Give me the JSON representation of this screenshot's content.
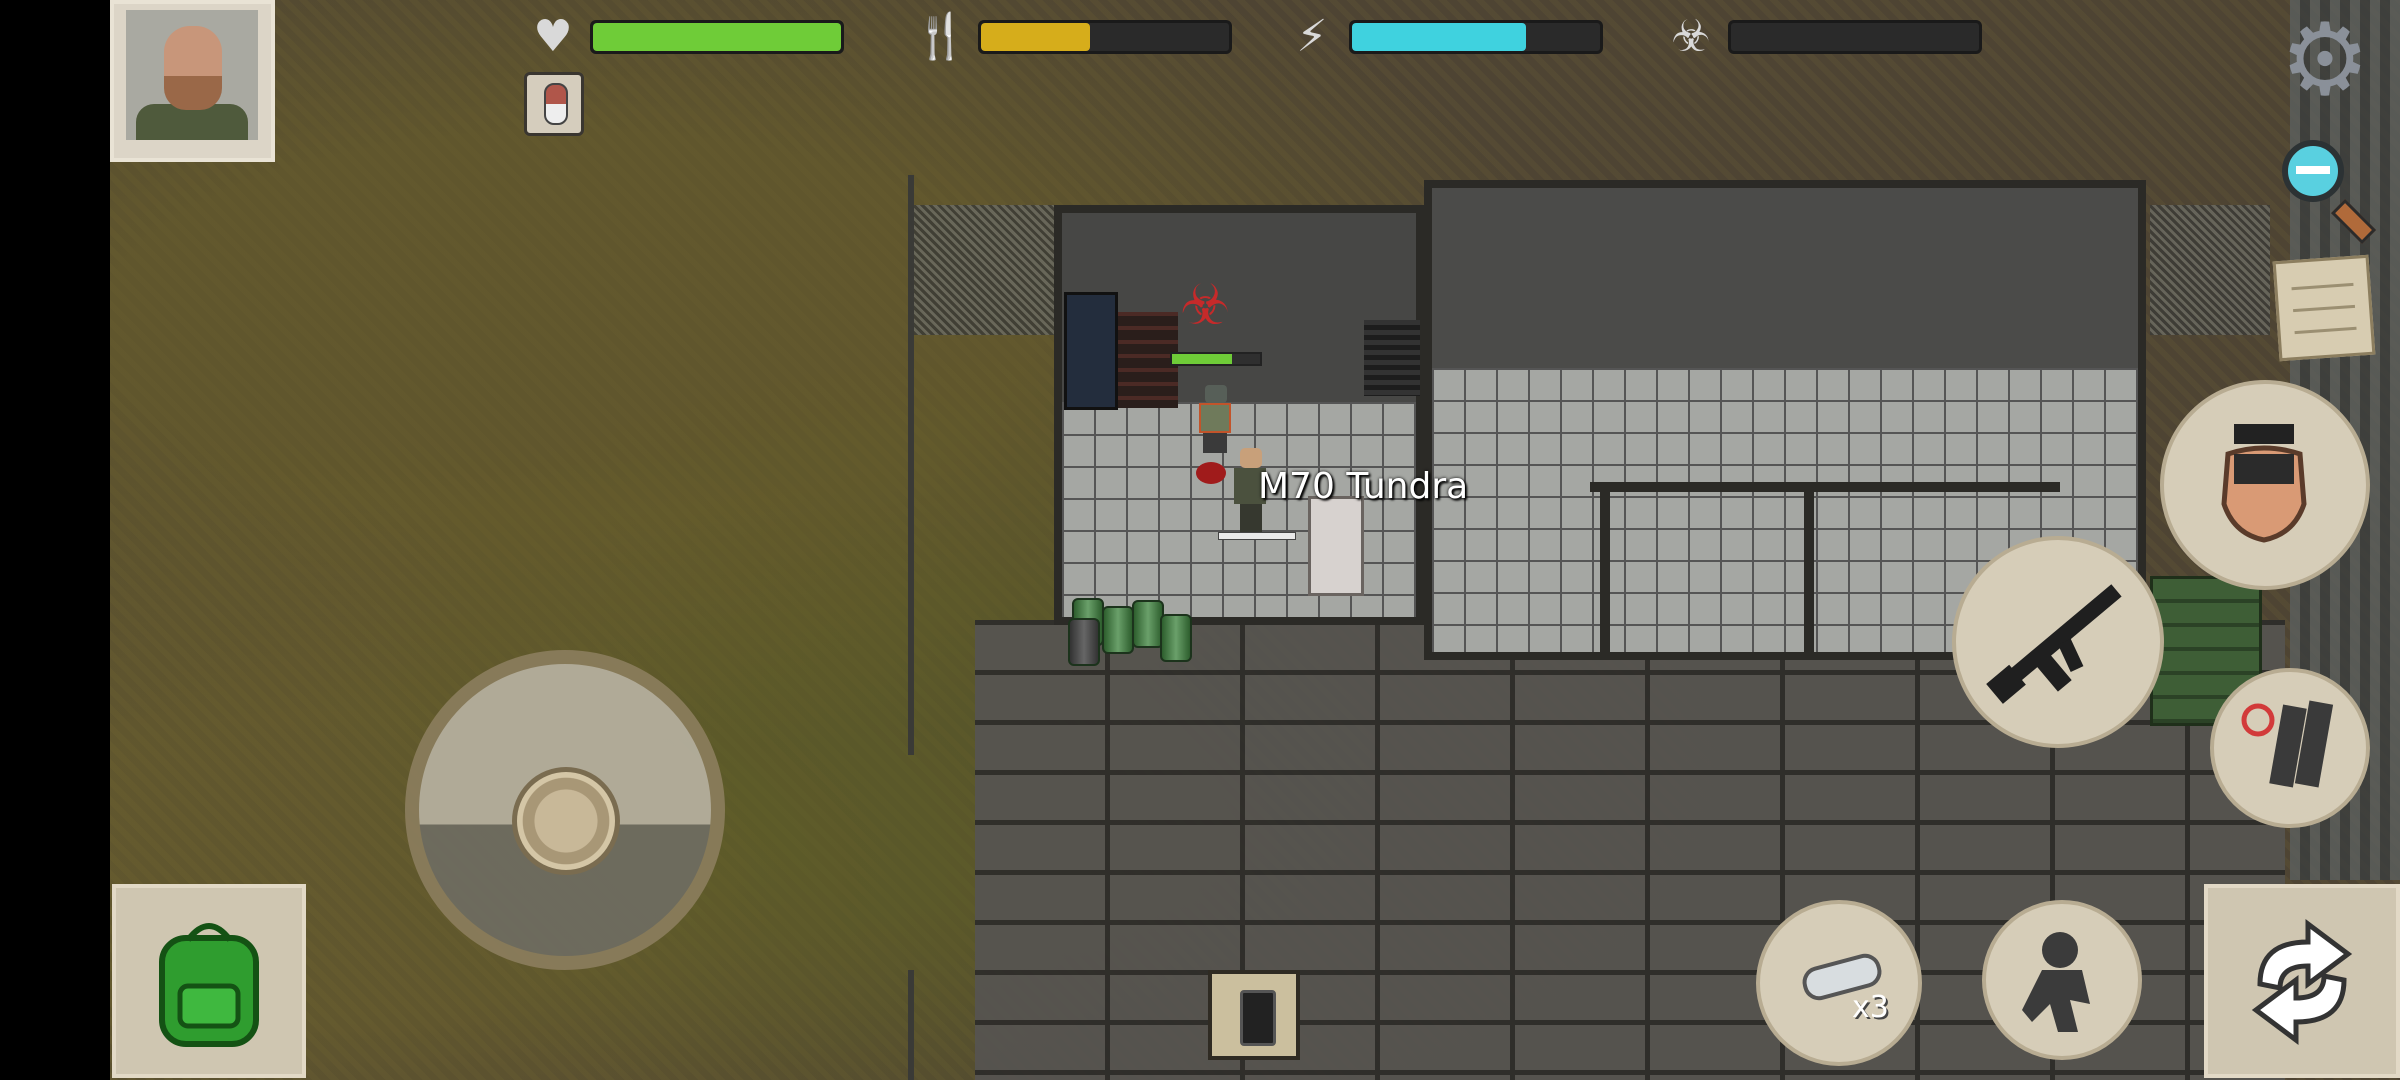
{
  "hud": {
    "stats": [
      {
        "name": "health",
        "icon": "heart-icon",
        "value": 1.0,
        "color": "#6fcc38"
      },
      {
        "name": "hunger",
        "icon": "fork-knife-icon",
        "value": 0.44,
        "color": "#d6ad1b"
      },
      {
        "name": "energy",
        "icon": "energy-head-icon",
        "value": 0.7,
        "color": "#3fd2df"
      },
      {
        "name": "infection",
        "icon": "biohazard-icon",
        "value": 0.0,
        "color": "#8a8a8a"
      }
    ],
    "status_effect_icon": "pill-capsule-icon"
  },
  "world": {
    "item_label": "M70 Tundra",
    "zombie_health": 0.68
  },
  "buttons": {
    "settings_icon": "gear-icon",
    "zoom_icon": "zoom-out-icon",
    "map_icon": "map-icon",
    "grab_icon": "grab-hand-icon",
    "weapon_icon": "assault-rifle-icon",
    "reload_icon": "magazine-reload-icon",
    "inventory_icon": "backpack-icon",
    "quick_slot_icon": "bandage-icon",
    "quick_slot_count": "x3",
    "sneak_icon": "sneak-icon",
    "swap_icon": "swap-arrows-icon",
    "radio_icon": "walkie-talkie-icon"
  }
}
